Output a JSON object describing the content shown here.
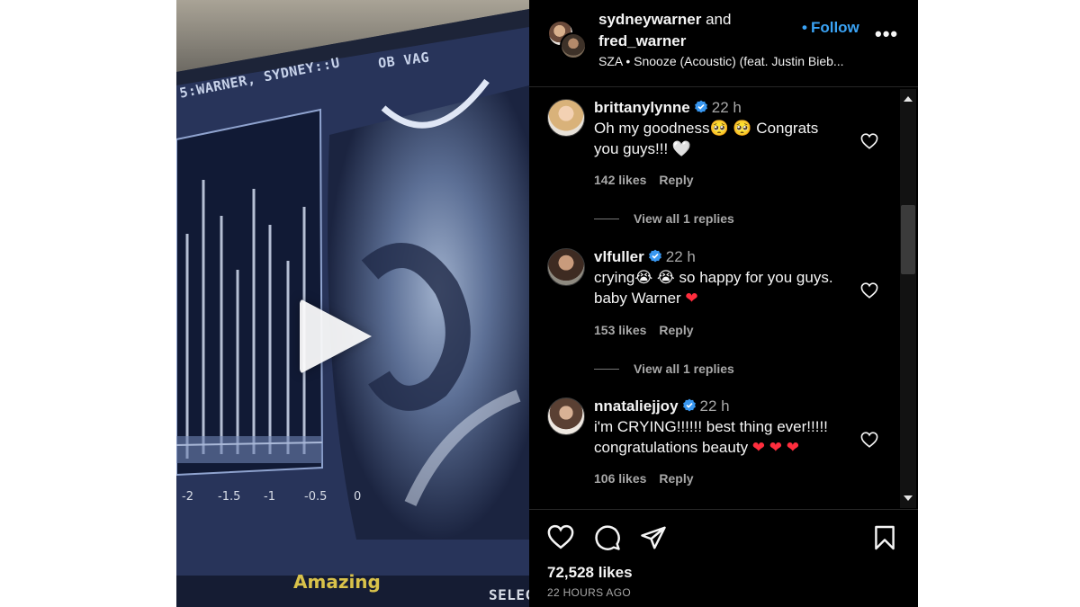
{
  "media": {
    "screen_label_left": "5:WARNER, SYDNEY::U",
    "screen_label_right": "OB VAG",
    "axis_ticks": [
      "-2",
      "-1.5",
      "-1",
      "-0.5",
      "0"
    ],
    "caption": "Amazing",
    "corner_text": "SELEC"
  },
  "header": {
    "user1": "sydneywarner",
    "and_text": "and",
    "user2": "fred_warner",
    "song": "SZA • Snooze (Acoustic) (feat. Justin Bieb...",
    "follow_label": "Follow",
    "more_label": "•••"
  },
  "comments": [
    {
      "username": "brittanylynne",
      "time": "22 h",
      "text_line1": "Oh my goodness🥺 🥺 Congrats",
      "text_line2": "you guys!!! 🤍",
      "likes": "142 likes",
      "reply_label": "Reply",
      "view_replies": "View all 1 replies"
    },
    {
      "username": "vlfuller",
      "time": "22 h",
      "text_line1": "crying😭 😭 so happy for you guys.",
      "text_line2": "baby Warner ",
      "heart": "❤",
      "likes": "153 likes",
      "reply_label": "Reply",
      "view_replies": "View all 1 replies"
    },
    {
      "username": "nnataliejjoy",
      "time": "22 h",
      "text_line1": "i'm CRYING!!!!!! best thing ever!!!!!",
      "text_line2": "congratulations beauty ",
      "heart": "❤ ❤ ❤",
      "likes": "106 likes",
      "reply_label": "Reply"
    }
  ],
  "footer": {
    "likes": "72,528 likes",
    "time_ago": "22 HOURS AGO"
  },
  "colors": {
    "background": "#000000",
    "accent": "#3aa3f5",
    "heart_red": "#ff2d3d",
    "verified": "#3897f0"
  }
}
